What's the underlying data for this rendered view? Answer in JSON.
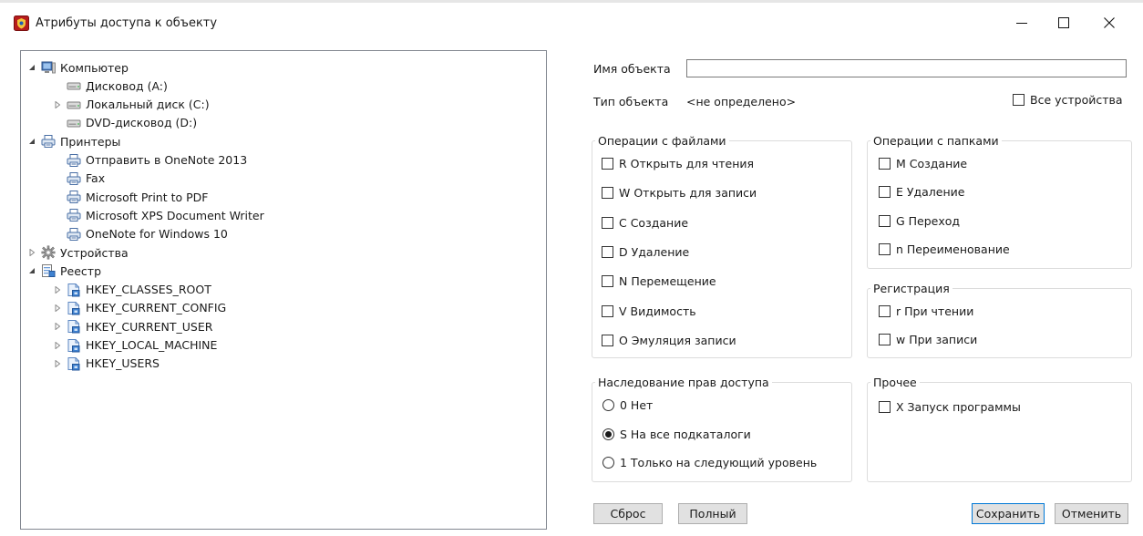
{
  "window": {
    "title": "Атрибуты доступа к объекту",
    "app_icon": "app-shield-icon",
    "controls": [
      "minimize",
      "maximize",
      "close"
    ]
  },
  "tree": [
    {
      "label": "Компьютер",
      "icon": "computer-icon",
      "level": 0,
      "expander": "expanded"
    },
    {
      "label": "Дисковод (A:)",
      "icon": "drive-icon",
      "level": 1,
      "expander": "none"
    },
    {
      "label": "Локальный диск (C:)",
      "icon": "drive-icon",
      "level": 1,
      "expander": "collapsed"
    },
    {
      "label": "DVD-дисковод (D:)",
      "icon": "drive-icon",
      "level": 1,
      "expander": "none"
    },
    {
      "label": "Принтеры",
      "icon": "printer-icon",
      "level": 0,
      "expander": "expanded"
    },
    {
      "label": "Отправить в OneNote 2013",
      "icon": "printer-icon",
      "level": 1,
      "expander": "none"
    },
    {
      "label": "Fax",
      "icon": "printer-icon",
      "level": 1,
      "expander": "none"
    },
    {
      "label": "Microsoft Print to PDF",
      "icon": "printer-icon",
      "level": 1,
      "expander": "none"
    },
    {
      "label": "Microsoft XPS Document Writer",
      "icon": "printer-icon",
      "level": 1,
      "expander": "none"
    },
    {
      "label": "OneNote for Windows 10",
      "icon": "printer-icon",
      "level": 1,
      "expander": "none"
    },
    {
      "label": "Устройства",
      "icon": "gear-icon",
      "level": 0,
      "expander": "collapsed"
    },
    {
      "label": "Реестр",
      "icon": "registry-icon",
      "level": 0,
      "expander": "expanded"
    },
    {
      "label": "HKEY_CLASSES_ROOT",
      "icon": "registry-key-icon",
      "level": 1,
      "expander": "collapsed"
    },
    {
      "label": "HKEY_CURRENT_CONFIG",
      "icon": "registry-key-icon",
      "level": 1,
      "expander": "collapsed"
    },
    {
      "label": "HKEY_CURRENT_USER",
      "icon": "registry-key-icon",
      "level": 1,
      "expander": "collapsed"
    },
    {
      "label": "HKEY_LOCAL_MACHINE",
      "icon": "registry-key-icon",
      "level": 1,
      "expander": "collapsed"
    },
    {
      "label": "HKEY_USERS",
      "icon": "registry-key-icon",
      "level": 1,
      "expander": "collapsed"
    }
  ],
  "object": {
    "name_label": "Имя объекта",
    "name_value": "",
    "type_label": "Тип объекта",
    "type_value": "<не определено>",
    "all_devices_label": "Все устройства",
    "all_devices_checked": false
  },
  "file_ops": {
    "legend": "Операции с файлами",
    "items": [
      {
        "label": "R Открыть для чтения",
        "checked": false
      },
      {
        "label": "W Открыть для записи",
        "checked": false
      },
      {
        "label": "C Создание",
        "checked": false
      },
      {
        "label": "D Удаление",
        "checked": false
      },
      {
        "label": "N Перемещение",
        "checked": false
      },
      {
        "label": "V Видимость",
        "checked": false
      },
      {
        "label": "O Эмуляция записи",
        "checked": false
      }
    ]
  },
  "folder_ops": {
    "legend": "Операции с папками",
    "items": [
      {
        "label": "M Создание",
        "checked": false
      },
      {
        "label": "E Удаление",
        "checked": false
      },
      {
        "label": "G Переход",
        "checked": false
      },
      {
        "label": "n Переименование",
        "checked": false
      }
    ]
  },
  "registration": {
    "legend": "Регистрация",
    "items": [
      {
        "label": "r При чтении",
        "checked": false
      },
      {
        "label": "w При записи",
        "checked": false
      }
    ]
  },
  "inheritance": {
    "legend": "Наследование прав доступа",
    "options": [
      {
        "label": "0 Нет",
        "selected": false
      },
      {
        "label": "S На все подкаталоги",
        "selected": true
      },
      {
        "label": "1 Только на следующий уровень",
        "selected": false
      }
    ]
  },
  "other": {
    "legend": "Прочее",
    "items": [
      {
        "label": "X Запуск программы",
        "checked": false
      }
    ]
  },
  "buttons": {
    "reset": "Сброс",
    "full": "Полный",
    "save": "Сохранить",
    "cancel": "Отменить"
  },
  "colors": {
    "accent": "#0078d7",
    "button_face": "#e1e1e1",
    "group_border": "#dcdcdc",
    "tree_border": "#828790"
  }
}
